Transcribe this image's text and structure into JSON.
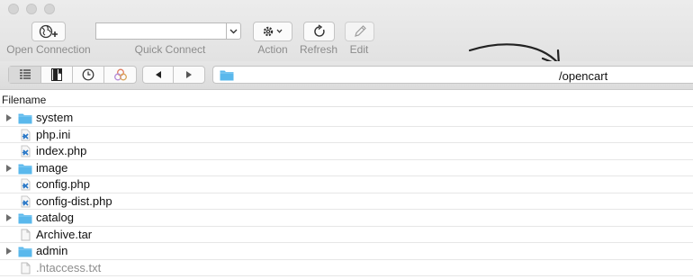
{
  "toolbar": {
    "open_connection": "Open Connection",
    "quick_connect": "Quick Connect",
    "action": "Action",
    "refresh": "Refresh",
    "edit": "Edit"
  },
  "nav": {
    "path": "/opencart"
  },
  "columns": {
    "filename": "Filename"
  },
  "files": [
    {
      "name": "system",
      "type": "folder"
    },
    {
      "name": "php.ini",
      "type": "file-code"
    },
    {
      "name": "index.php",
      "type": "file-code"
    },
    {
      "name": "image",
      "type": "folder"
    },
    {
      "name": "config.php",
      "type": "file-code"
    },
    {
      "name": "config-dist.php",
      "type": "file-code"
    },
    {
      "name": "catalog",
      "type": "folder"
    },
    {
      "name": "Archive.tar",
      "type": "file"
    },
    {
      "name": "admin",
      "type": "folder"
    },
    {
      "name": ".htaccess.txt",
      "type": "file"
    }
  ],
  "colors": {
    "folder": "#5ab8ec",
    "code_icon": "#2a78c7",
    "arrow": "#222222"
  }
}
